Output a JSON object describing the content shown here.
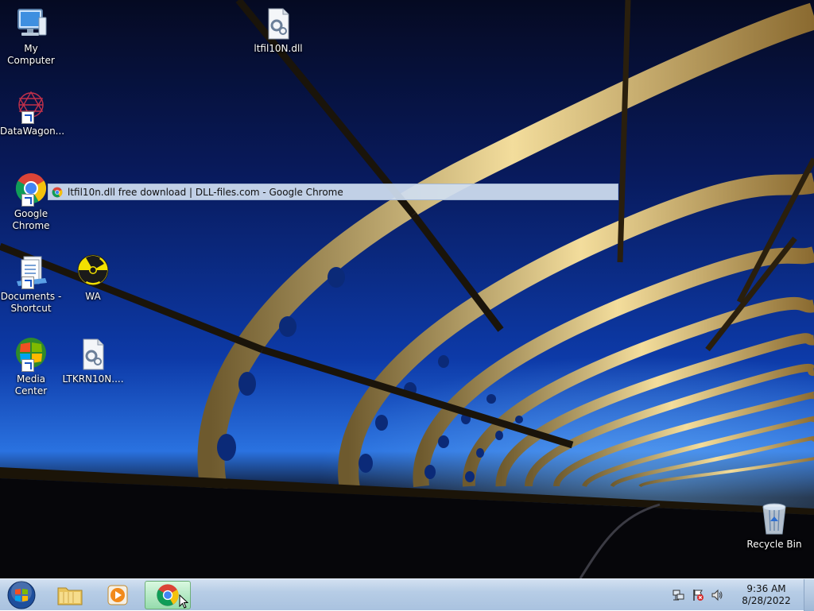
{
  "desktop": {
    "icons": [
      {
        "label": "My Computer",
        "icon": "computer-icon"
      },
      {
        "label": "ltfil10N.dll",
        "icon": "dll-file-icon"
      },
      {
        "label": "DataWagon...",
        "icon": "datawagon-icon"
      },
      {
        "label": "Google Chrome",
        "icon": "chrome-icon"
      },
      {
        "label": "Documents - Shortcut",
        "icon": "documents-icon"
      },
      {
        "label": "WA",
        "icon": "radiation-icon"
      },
      {
        "label": "Media Center",
        "icon": "media-center-icon"
      },
      {
        "label": "LTKRN10N....",
        "icon": "dll-file-icon"
      },
      {
        "label": "Recycle Bin",
        "icon": "recycle-bin-icon"
      }
    ]
  },
  "tooltip": {
    "text": "ltfil10n.dll free download | DLL-files.com - Google Chrome",
    "icon": "chrome-icon"
  },
  "taskbar": {
    "start_icon": "windows-orb-icon",
    "pinned": [
      {
        "icon": "explorer-folder-icon"
      },
      {
        "icon": "media-player-icon"
      },
      {
        "icon": "chrome-icon",
        "active": true
      }
    ],
    "tray_icons": [
      "network-icon",
      "action-center-flag-icon",
      "volume-icon"
    ],
    "clock": {
      "time": "9:36 AM",
      "date": "8/28/2022"
    }
  },
  "colors": {
    "taskbar": "#b7cde6",
    "tooltip_bg": "#d0def0",
    "sky_top": "#050a22",
    "sky_horizon": "#2a72e0",
    "bridge_glow": "#f0d38a"
  }
}
